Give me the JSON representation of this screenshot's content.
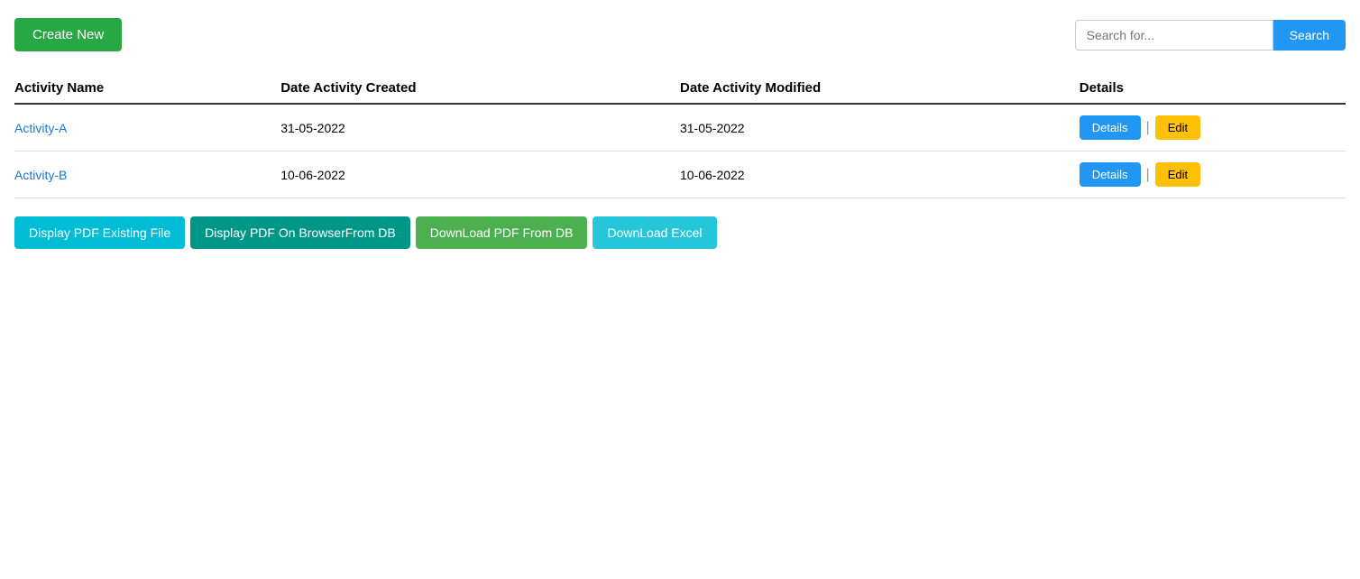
{
  "header": {
    "create_new_label": "Create New",
    "search_placeholder": "Search for...",
    "search_button_label": "Search"
  },
  "table": {
    "columns": [
      {
        "key": "activity_name",
        "label": "Activity Name"
      },
      {
        "key": "date_created",
        "label": "Date Activity Created"
      },
      {
        "key": "date_modified",
        "label": "Date Activity Modified"
      },
      {
        "key": "details",
        "label": "Details"
      }
    ],
    "rows": [
      {
        "activity_name": "Activity-A",
        "date_created": "31-05-2022",
        "date_modified": "31-05-2022",
        "details_label": "Details",
        "edit_label": "Edit"
      },
      {
        "activity_name": "Activity-B",
        "date_created": "10-06-2022",
        "date_modified": "10-06-2022",
        "details_label": "Details",
        "edit_label": "Edit"
      }
    ]
  },
  "bottom_buttons": [
    {
      "label": "Display PDF Existing File",
      "style": "cyan"
    },
    {
      "label": "Display PDF On BrowserFrom DB",
      "style": "teal"
    },
    {
      "label": "DownLoad PDF From DB",
      "style": "green"
    },
    {
      "label": "DownLoad Excel",
      "style": "mint"
    }
  ],
  "colors": {
    "create_new_bg": "#28a745",
    "search_btn_bg": "#2196f3",
    "details_btn_bg": "#2196f3",
    "edit_btn_bg": "#ffc107",
    "btn_cyan": "#00bcd4",
    "btn_teal": "#009688",
    "btn_green": "#4caf50",
    "btn_mint": "#26c6da"
  }
}
